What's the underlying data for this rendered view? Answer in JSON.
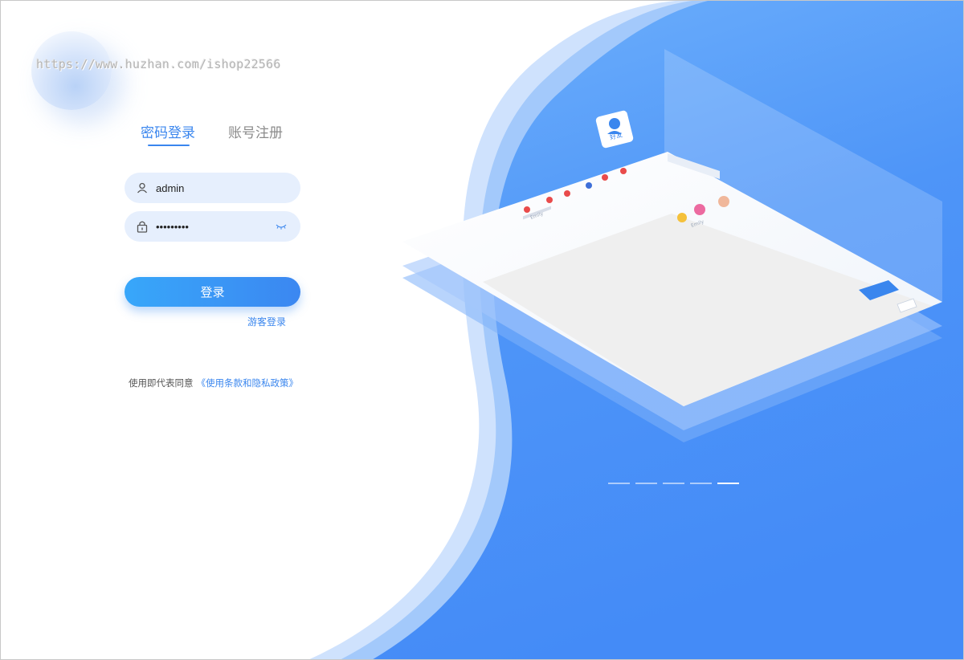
{
  "watermark": "https://www.huzhan.com/ishop22566",
  "tabs": {
    "login": "密码登录",
    "register": "账号注册"
  },
  "form": {
    "username_value": "admin",
    "password_value": "•••••••••",
    "login_label": "登录",
    "guest_label": "游客登录"
  },
  "agreement": {
    "prefix": "使用即代表同意",
    "terms_link": "《使用条款和隐私政策》"
  },
  "illustration": {
    "friend_badge": "好友"
  },
  "carousel": {
    "slides": 5,
    "active_index": 4
  },
  "colors": {
    "accent": "#3a86ee",
    "background_blue": "#4d92f8"
  }
}
